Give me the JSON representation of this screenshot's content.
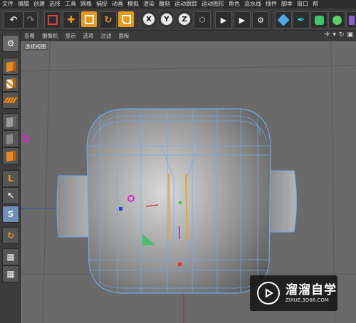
{
  "menu": [
    "文件",
    "编辑",
    "创建",
    "选择",
    "工具",
    "网格",
    "捕捉",
    "动画",
    "模拟",
    "渲染",
    "雕刻",
    "运动跟踪",
    "运动图形",
    "角色",
    "流水线",
    "插件",
    "脚本",
    "窗口",
    "帮"
  ],
  "viewport_menu": [
    "查看",
    "摄像机",
    "显示",
    "选项",
    "过滤",
    "面板"
  ],
  "viewport_title": "透视视图",
  "axis_buttons": {
    "x": "X",
    "y": "Y",
    "z": "Z"
  },
  "watermark": {
    "main": "溜溜自学",
    "sub": "ZIXUE.3D66.COM"
  },
  "colors": {
    "accent": "#e69a1c",
    "mesh_wire": "#6fa8e8",
    "active_tool": "#6f8fb8"
  }
}
